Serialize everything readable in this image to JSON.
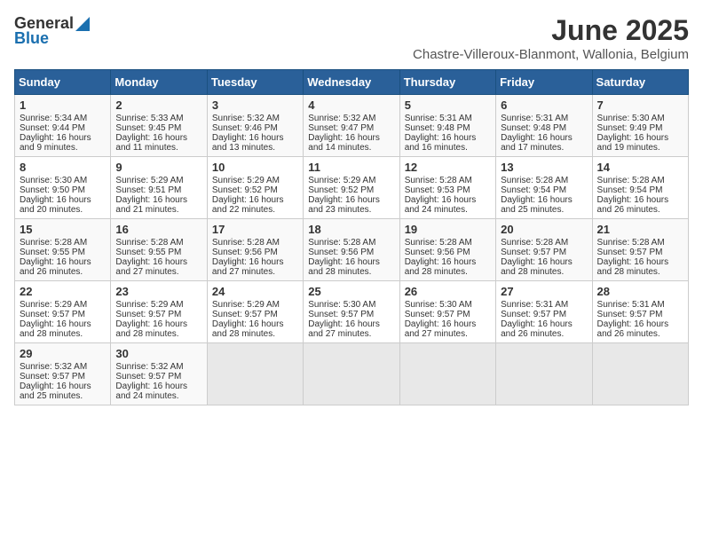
{
  "logo": {
    "general": "General",
    "blue": "Blue"
  },
  "title": "June 2025",
  "location": "Chastre-Villeroux-Blanmont, Wallonia, Belgium",
  "weekdays": [
    "Sunday",
    "Monday",
    "Tuesday",
    "Wednesday",
    "Thursday",
    "Friday",
    "Saturday"
  ],
  "weeks": [
    [
      {
        "day": "1",
        "sunrise": "Sunrise: 5:34 AM",
        "sunset": "Sunset: 9:44 PM",
        "daylight": "Daylight: 16 hours and 9 minutes."
      },
      {
        "day": "2",
        "sunrise": "Sunrise: 5:33 AM",
        "sunset": "Sunset: 9:45 PM",
        "daylight": "Daylight: 16 hours and 11 minutes."
      },
      {
        "day": "3",
        "sunrise": "Sunrise: 5:32 AM",
        "sunset": "Sunset: 9:46 PM",
        "daylight": "Daylight: 16 hours and 13 minutes."
      },
      {
        "day": "4",
        "sunrise": "Sunrise: 5:32 AM",
        "sunset": "Sunset: 9:47 PM",
        "daylight": "Daylight: 16 hours and 14 minutes."
      },
      {
        "day": "5",
        "sunrise": "Sunrise: 5:31 AM",
        "sunset": "Sunset: 9:48 PM",
        "daylight": "Daylight: 16 hours and 16 minutes."
      },
      {
        "day": "6",
        "sunrise": "Sunrise: 5:31 AM",
        "sunset": "Sunset: 9:48 PM",
        "daylight": "Daylight: 16 hours and 17 minutes."
      },
      {
        "day": "7",
        "sunrise": "Sunrise: 5:30 AM",
        "sunset": "Sunset: 9:49 PM",
        "daylight": "Daylight: 16 hours and 19 minutes."
      }
    ],
    [
      {
        "day": "8",
        "sunrise": "Sunrise: 5:30 AM",
        "sunset": "Sunset: 9:50 PM",
        "daylight": "Daylight: 16 hours and 20 minutes."
      },
      {
        "day": "9",
        "sunrise": "Sunrise: 5:29 AM",
        "sunset": "Sunset: 9:51 PM",
        "daylight": "Daylight: 16 hours and 21 minutes."
      },
      {
        "day": "10",
        "sunrise": "Sunrise: 5:29 AM",
        "sunset": "Sunset: 9:52 PM",
        "daylight": "Daylight: 16 hours and 22 minutes."
      },
      {
        "day": "11",
        "sunrise": "Sunrise: 5:29 AM",
        "sunset": "Sunset: 9:52 PM",
        "daylight": "Daylight: 16 hours and 23 minutes."
      },
      {
        "day": "12",
        "sunrise": "Sunrise: 5:28 AM",
        "sunset": "Sunset: 9:53 PM",
        "daylight": "Daylight: 16 hours and 24 minutes."
      },
      {
        "day": "13",
        "sunrise": "Sunrise: 5:28 AM",
        "sunset": "Sunset: 9:54 PM",
        "daylight": "Daylight: 16 hours and 25 minutes."
      },
      {
        "day": "14",
        "sunrise": "Sunrise: 5:28 AM",
        "sunset": "Sunset: 9:54 PM",
        "daylight": "Daylight: 16 hours and 26 minutes."
      }
    ],
    [
      {
        "day": "15",
        "sunrise": "Sunrise: 5:28 AM",
        "sunset": "Sunset: 9:55 PM",
        "daylight": "Daylight: 16 hours and 26 minutes."
      },
      {
        "day": "16",
        "sunrise": "Sunrise: 5:28 AM",
        "sunset": "Sunset: 9:55 PM",
        "daylight": "Daylight: 16 hours and 27 minutes."
      },
      {
        "day": "17",
        "sunrise": "Sunrise: 5:28 AM",
        "sunset": "Sunset: 9:56 PM",
        "daylight": "Daylight: 16 hours and 27 minutes."
      },
      {
        "day": "18",
        "sunrise": "Sunrise: 5:28 AM",
        "sunset": "Sunset: 9:56 PM",
        "daylight": "Daylight: 16 hours and 28 minutes."
      },
      {
        "day": "19",
        "sunrise": "Sunrise: 5:28 AM",
        "sunset": "Sunset: 9:56 PM",
        "daylight": "Daylight: 16 hours and 28 minutes."
      },
      {
        "day": "20",
        "sunrise": "Sunrise: 5:28 AM",
        "sunset": "Sunset: 9:57 PM",
        "daylight": "Daylight: 16 hours and 28 minutes."
      },
      {
        "day": "21",
        "sunrise": "Sunrise: 5:28 AM",
        "sunset": "Sunset: 9:57 PM",
        "daylight": "Daylight: 16 hours and 28 minutes."
      }
    ],
    [
      {
        "day": "22",
        "sunrise": "Sunrise: 5:29 AM",
        "sunset": "Sunset: 9:57 PM",
        "daylight": "Daylight: 16 hours and 28 minutes."
      },
      {
        "day": "23",
        "sunrise": "Sunrise: 5:29 AM",
        "sunset": "Sunset: 9:57 PM",
        "daylight": "Daylight: 16 hours and 28 minutes."
      },
      {
        "day": "24",
        "sunrise": "Sunrise: 5:29 AM",
        "sunset": "Sunset: 9:57 PM",
        "daylight": "Daylight: 16 hours and 28 minutes."
      },
      {
        "day": "25",
        "sunrise": "Sunrise: 5:30 AM",
        "sunset": "Sunset: 9:57 PM",
        "daylight": "Daylight: 16 hours and 27 minutes."
      },
      {
        "day": "26",
        "sunrise": "Sunrise: 5:30 AM",
        "sunset": "Sunset: 9:57 PM",
        "daylight": "Daylight: 16 hours and 27 minutes."
      },
      {
        "day": "27",
        "sunrise": "Sunrise: 5:31 AM",
        "sunset": "Sunset: 9:57 PM",
        "daylight": "Daylight: 16 hours and 26 minutes."
      },
      {
        "day": "28",
        "sunrise": "Sunrise: 5:31 AM",
        "sunset": "Sunset: 9:57 PM",
        "daylight": "Daylight: 16 hours and 26 minutes."
      }
    ],
    [
      {
        "day": "29",
        "sunrise": "Sunrise: 5:32 AM",
        "sunset": "Sunset: 9:57 PM",
        "daylight": "Daylight: 16 hours and 25 minutes."
      },
      {
        "day": "30",
        "sunrise": "Sunrise: 5:32 AM",
        "sunset": "Sunset: 9:57 PM",
        "daylight": "Daylight: 16 hours and 24 minutes."
      },
      null,
      null,
      null,
      null,
      null
    ]
  ]
}
